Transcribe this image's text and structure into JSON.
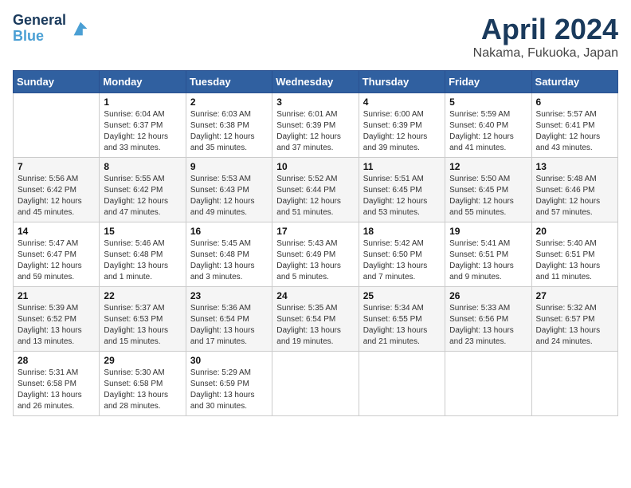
{
  "header": {
    "logo_line1": "General",
    "logo_line2": "Blue",
    "title": "April 2024",
    "subtitle": "Nakama, Fukuoka, Japan"
  },
  "weekdays": [
    "Sunday",
    "Monday",
    "Tuesday",
    "Wednesday",
    "Thursday",
    "Friday",
    "Saturday"
  ],
  "weeks": [
    [
      {
        "day": "",
        "sunrise": "",
        "sunset": "",
        "daylight": ""
      },
      {
        "day": "1",
        "sunrise": "Sunrise: 6:04 AM",
        "sunset": "Sunset: 6:37 PM",
        "daylight": "Daylight: 12 hours and 33 minutes."
      },
      {
        "day": "2",
        "sunrise": "Sunrise: 6:03 AM",
        "sunset": "Sunset: 6:38 PM",
        "daylight": "Daylight: 12 hours and 35 minutes."
      },
      {
        "day": "3",
        "sunrise": "Sunrise: 6:01 AM",
        "sunset": "Sunset: 6:39 PM",
        "daylight": "Daylight: 12 hours and 37 minutes."
      },
      {
        "day": "4",
        "sunrise": "Sunrise: 6:00 AM",
        "sunset": "Sunset: 6:39 PM",
        "daylight": "Daylight: 12 hours and 39 minutes."
      },
      {
        "day": "5",
        "sunrise": "Sunrise: 5:59 AM",
        "sunset": "Sunset: 6:40 PM",
        "daylight": "Daylight: 12 hours and 41 minutes."
      },
      {
        "day": "6",
        "sunrise": "Sunrise: 5:57 AM",
        "sunset": "Sunset: 6:41 PM",
        "daylight": "Daylight: 12 hours and 43 minutes."
      }
    ],
    [
      {
        "day": "7",
        "sunrise": "Sunrise: 5:56 AM",
        "sunset": "Sunset: 6:42 PM",
        "daylight": "Daylight: 12 hours and 45 minutes."
      },
      {
        "day": "8",
        "sunrise": "Sunrise: 5:55 AM",
        "sunset": "Sunset: 6:42 PM",
        "daylight": "Daylight: 12 hours and 47 minutes."
      },
      {
        "day": "9",
        "sunrise": "Sunrise: 5:53 AM",
        "sunset": "Sunset: 6:43 PM",
        "daylight": "Daylight: 12 hours and 49 minutes."
      },
      {
        "day": "10",
        "sunrise": "Sunrise: 5:52 AM",
        "sunset": "Sunset: 6:44 PM",
        "daylight": "Daylight: 12 hours and 51 minutes."
      },
      {
        "day": "11",
        "sunrise": "Sunrise: 5:51 AM",
        "sunset": "Sunset: 6:45 PM",
        "daylight": "Daylight: 12 hours and 53 minutes."
      },
      {
        "day": "12",
        "sunrise": "Sunrise: 5:50 AM",
        "sunset": "Sunset: 6:45 PM",
        "daylight": "Daylight: 12 hours and 55 minutes."
      },
      {
        "day": "13",
        "sunrise": "Sunrise: 5:48 AM",
        "sunset": "Sunset: 6:46 PM",
        "daylight": "Daylight: 12 hours and 57 minutes."
      }
    ],
    [
      {
        "day": "14",
        "sunrise": "Sunrise: 5:47 AM",
        "sunset": "Sunset: 6:47 PM",
        "daylight": "Daylight: 12 hours and 59 minutes."
      },
      {
        "day": "15",
        "sunrise": "Sunrise: 5:46 AM",
        "sunset": "Sunset: 6:48 PM",
        "daylight": "Daylight: 13 hours and 1 minute."
      },
      {
        "day": "16",
        "sunrise": "Sunrise: 5:45 AM",
        "sunset": "Sunset: 6:48 PM",
        "daylight": "Daylight: 13 hours and 3 minutes."
      },
      {
        "day": "17",
        "sunrise": "Sunrise: 5:43 AM",
        "sunset": "Sunset: 6:49 PM",
        "daylight": "Daylight: 13 hours and 5 minutes."
      },
      {
        "day": "18",
        "sunrise": "Sunrise: 5:42 AM",
        "sunset": "Sunset: 6:50 PM",
        "daylight": "Daylight: 13 hours and 7 minutes."
      },
      {
        "day": "19",
        "sunrise": "Sunrise: 5:41 AM",
        "sunset": "Sunset: 6:51 PM",
        "daylight": "Daylight: 13 hours and 9 minutes."
      },
      {
        "day": "20",
        "sunrise": "Sunrise: 5:40 AM",
        "sunset": "Sunset: 6:51 PM",
        "daylight": "Daylight: 13 hours and 11 minutes."
      }
    ],
    [
      {
        "day": "21",
        "sunrise": "Sunrise: 5:39 AM",
        "sunset": "Sunset: 6:52 PM",
        "daylight": "Daylight: 13 hours and 13 minutes."
      },
      {
        "day": "22",
        "sunrise": "Sunrise: 5:37 AM",
        "sunset": "Sunset: 6:53 PM",
        "daylight": "Daylight: 13 hours and 15 minutes."
      },
      {
        "day": "23",
        "sunrise": "Sunrise: 5:36 AM",
        "sunset": "Sunset: 6:54 PM",
        "daylight": "Daylight: 13 hours and 17 minutes."
      },
      {
        "day": "24",
        "sunrise": "Sunrise: 5:35 AM",
        "sunset": "Sunset: 6:54 PM",
        "daylight": "Daylight: 13 hours and 19 minutes."
      },
      {
        "day": "25",
        "sunrise": "Sunrise: 5:34 AM",
        "sunset": "Sunset: 6:55 PM",
        "daylight": "Daylight: 13 hours and 21 minutes."
      },
      {
        "day": "26",
        "sunrise": "Sunrise: 5:33 AM",
        "sunset": "Sunset: 6:56 PM",
        "daylight": "Daylight: 13 hours and 23 minutes."
      },
      {
        "day": "27",
        "sunrise": "Sunrise: 5:32 AM",
        "sunset": "Sunset: 6:57 PM",
        "daylight": "Daylight: 13 hours and 24 minutes."
      }
    ],
    [
      {
        "day": "28",
        "sunrise": "Sunrise: 5:31 AM",
        "sunset": "Sunset: 6:58 PM",
        "daylight": "Daylight: 13 hours and 26 minutes."
      },
      {
        "day": "29",
        "sunrise": "Sunrise: 5:30 AM",
        "sunset": "Sunset: 6:58 PM",
        "daylight": "Daylight: 13 hours and 28 minutes."
      },
      {
        "day": "30",
        "sunrise": "Sunrise: 5:29 AM",
        "sunset": "Sunset: 6:59 PM",
        "daylight": "Daylight: 13 hours and 30 minutes."
      },
      {
        "day": "",
        "sunrise": "",
        "sunset": "",
        "daylight": ""
      },
      {
        "day": "",
        "sunrise": "",
        "sunset": "",
        "daylight": ""
      },
      {
        "day": "",
        "sunrise": "",
        "sunset": "",
        "daylight": ""
      },
      {
        "day": "",
        "sunrise": "",
        "sunset": "",
        "daylight": ""
      }
    ]
  ]
}
